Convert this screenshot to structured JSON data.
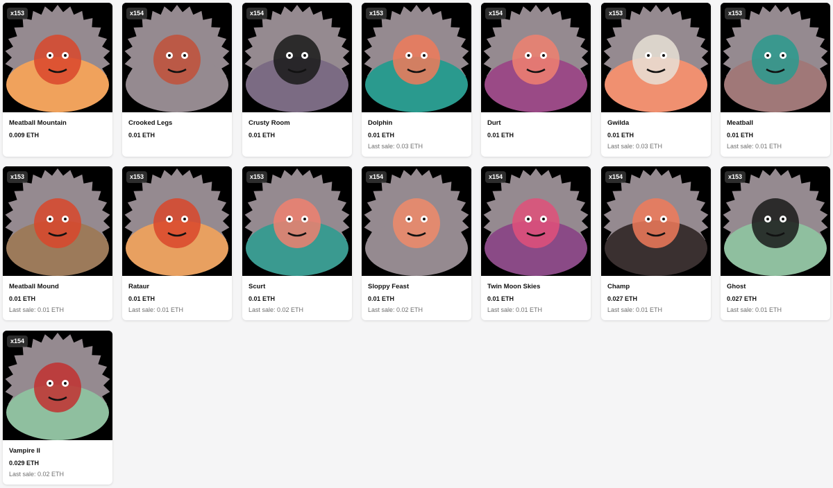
{
  "colors": {
    "page_background": "#f5f5f6",
    "badge_background": "#3c3c3c",
    "thumb_frame": "#000000",
    "starburst": "#958a90"
  },
  "items": [
    {
      "name": "Meatball Mountain",
      "badge": "x153",
      "price": "0.009 ETH",
      "last_sale": "",
      "bg": "#f0a25c",
      "accent": "#d9462b"
    },
    {
      "name": "Crooked Legs",
      "badge": "x154",
      "price": "0.01 ETH",
      "last_sale": "",
      "bg": "#958a90",
      "accent": "#c2503a"
    },
    {
      "name": "Crusty Room",
      "badge": "x154",
      "price": "0.01 ETH",
      "last_sale": "",
      "bg": "#7b6b83",
      "accent": "#1a1a1a"
    },
    {
      "name": "Dolphin",
      "badge": "x153",
      "price": "0.01 ETH",
      "last_sale": "Last sale: 0.03 ETH",
      "bg": "#2a9a8e",
      "accent": "#f07a5a"
    },
    {
      "name": "Durt",
      "badge": "x154",
      "price": "0.01 ETH",
      "last_sale": "",
      "bg": "#9a4a86",
      "accent": "#f08070"
    },
    {
      "name": "Gwilda",
      "badge": "x153",
      "price": "0.01 ETH",
      "last_sale": "Last sale: 0.03 ETH",
      "bg": "#f09070",
      "accent": "#e8e0d6"
    },
    {
      "name": "Meatball",
      "badge": "x153",
      "price": "0.01 ETH",
      "last_sale": "Last sale: 0.01 ETH",
      "bg": "#a07878",
      "accent": "#2a9a8e"
    },
    {
      "name": "Meatball Mound",
      "badge": "x153",
      "price": "0.01 ETH",
      "last_sale": "Last sale: 0.01 ETH",
      "bg": "#9c7a5a",
      "accent": "#d9462b"
    },
    {
      "name": "Rataur",
      "badge": "x153",
      "price": "0.01 ETH",
      "last_sale": "Last sale: 0.01 ETH",
      "bg": "#e8a060",
      "accent": "#d9462b"
    },
    {
      "name": "Scurt",
      "badge": "x153",
      "price": "0.01 ETH",
      "last_sale": "Last sale: 0.02 ETH",
      "bg": "#3a9a90",
      "accent": "#f08070"
    },
    {
      "name": "Sloppy Feast",
      "badge": "x154",
      "price": "0.01 ETH",
      "last_sale": "Last sale: 0.02 ETH",
      "bg": "#958a90",
      "accent": "#f08a6a"
    },
    {
      "name": "Twin Moon Skies",
      "badge": "x154",
      "price": "0.01 ETH",
      "last_sale": "Last sale: 0.01 ETH",
      "bg": "#8a4a86",
      "accent": "#e0507a"
    },
    {
      "name": "Champ",
      "badge": "x154",
      "price": "0.027 ETH",
      "last_sale": "Last sale: 0.01 ETH",
      "bg": "#3a3030",
      "accent": "#f07a5a"
    },
    {
      "name": "Ghost",
      "badge": "x153",
      "price": "0.027 ETH",
      "last_sale": "Last sale: 0.01 ETH",
      "bg": "#8fbf9f",
      "accent": "#1a1a1a"
    },
    {
      "name": "Vampire II",
      "badge": "x154",
      "price": "0.029 ETH",
      "last_sale": "Last sale: 0.02 ETH",
      "bg": "#8fbf9f",
      "accent": "#c23030"
    }
  ]
}
